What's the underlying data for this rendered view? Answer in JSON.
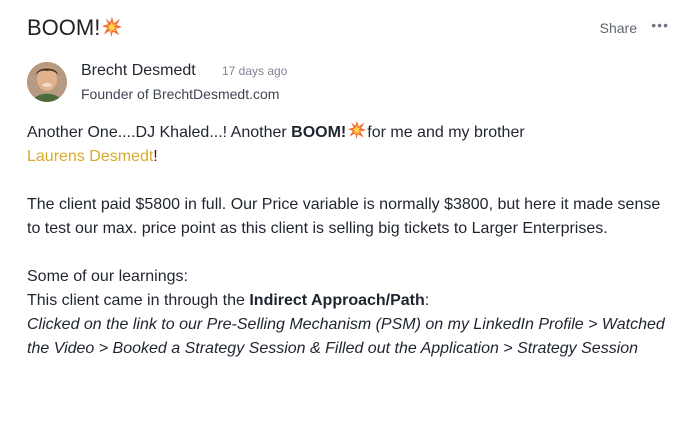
{
  "post": {
    "title": "BOOM!",
    "share_label": "Share",
    "more_label": "•••",
    "author": {
      "name": "Brecht Desmedt",
      "timestamp": "17 days ago",
      "role": "Founder of BrechtDesmedt.com"
    },
    "body": {
      "line1_prefix": "Another One....DJ Khaled...! Another ",
      "line1_bold": "BOOM!",
      "line1_suffix": "for me and my brother",
      "mention": "Laurens Desmedt",
      "mention_suffix": "!",
      "paragraph2": "The client paid $5800 in full. Our Price variable is normally $3800, but here it made sense to test our max. price point as this client is selling big tickets to Larger Enterprises.",
      "learnings_heading": "Some of our learnings:",
      "learning_prefix": "This client came in through the ",
      "learning_bold": "Indirect Approach/Path",
      "learning_suffix": ":",
      "learning_italic": "Clicked on the link to our Pre-Selling Mechanism (PSM) on my LinkedIn Profile > Watched the Video > Booked a Strategy Session & Filled out the Application > Strategy Session"
    }
  },
  "icons": {
    "boom": "collision-emoji-icon",
    "more": "ellipsis-icon"
  },
  "colors": {
    "mention": "#d9a928",
    "text": "#1f2430",
    "muted": "#7c8390",
    "boom": "#ef6a2d"
  }
}
